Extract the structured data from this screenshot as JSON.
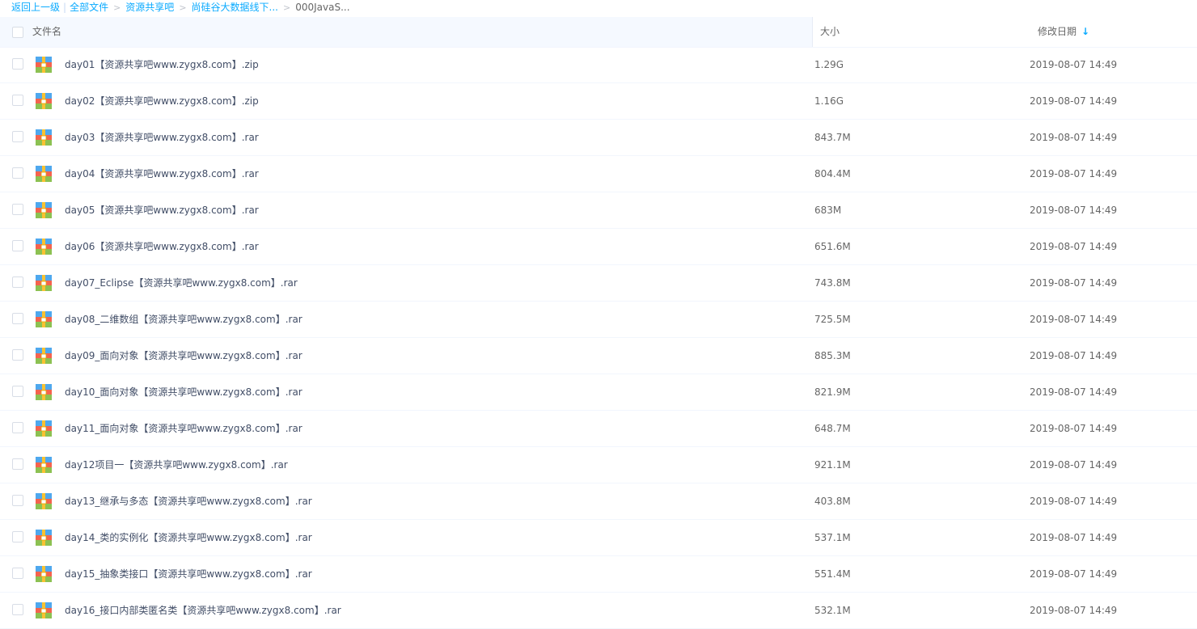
{
  "breadcrumb": {
    "back": "返回上一级",
    "all_files": "全部文件",
    "level1": "资源共享吧",
    "level2": "尚硅谷大数据线下...",
    "current": "000JavaS..."
  },
  "header": {
    "name": "文件名",
    "size": "大小",
    "modified": "修改日期"
  },
  "files": [
    {
      "name": "day01【资源共享吧www.zygx8.com】.zip",
      "size": "1.29G",
      "date": "2019-08-07 14:49"
    },
    {
      "name": "day02【资源共享吧www.zygx8.com】.zip",
      "size": "1.16G",
      "date": "2019-08-07 14:49"
    },
    {
      "name": "day03【资源共享吧www.zygx8.com】.rar",
      "size": "843.7M",
      "date": "2019-08-07 14:49"
    },
    {
      "name": "day04【资源共享吧www.zygx8.com】.rar",
      "size": "804.4M",
      "date": "2019-08-07 14:49"
    },
    {
      "name": "day05【资源共享吧www.zygx8.com】.rar",
      "size": "683M",
      "date": "2019-08-07 14:49"
    },
    {
      "name": "day06【资源共享吧www.zygx8.com】.rar",
      "size": "651.6M",
      "date": "2019-08-07 14:49"
    },
    {
      "name": "day07_Eclipse【资源共享吧www.zygx8.com】.rar",
      "size": "743.8M",
      "date": "2019-08-07 14:49"
    },
    {
      "name": "day08_二维数组【资源共享吧www.zygx8.com】.rar",
      "size": "725.5M",
      "date": "2019-08-07 14:49"
    },
    {
      "name": "day09_面向对象【资源共享吧www.zygx8.com】.rar",
      "size": "885.3M",
      "date": "2019-08-07 14:49"
    },
    {
      "name": "day10_面向对象【资源共享吧www.zygx8.com】.rar",
      "size": "821.9M",
      "date": "2019-08-07 14:49"
    },
    {
      "name": "day11_面向对象【资源共享吧www.zygx8.com】.rar",
      "size": "648.7M",
      "date": "2019-08-07 14:49"
    },
    {
      "name": "day12项目一【资源共享吧www.zygx8.com】.rar",
      "size": "921.1M",
      "date": "2019-08-07 14:49"
    },
    {
      "name": "day13_继承与多态【资源共享吧www.zygx8.com】.rar",
      "size": "403.8M",
      "date": "2019-08-07 14:49"
    },
    {
      "name": "day14_类的实例化【资源共享吧www.zygx8.com】.rar",
      "size": "537.1M",
      "date": "2019-08-07 14:49"
    },
    {
      "name": "day15_抽象类接口【资源共享吧www.zygx8.com】.rar",
      "size": "551.4M",
      "date": "2019-08-07 14:49"
    },
    {
      "name": "day16_接口内部类匿名类【资源共享吧www.zygx8.com】.rar",
      "size": "532.1M",
      "date": "2019-08-07 14:49"
    }
  ],
  "icons": {
    "file": "archive-file-icon",
    "sort": "arrow-down-icon"
  },
  "colors": {
    "link": "#09aaff",
    "header_bg": "#f5f9ff"
  }
}
